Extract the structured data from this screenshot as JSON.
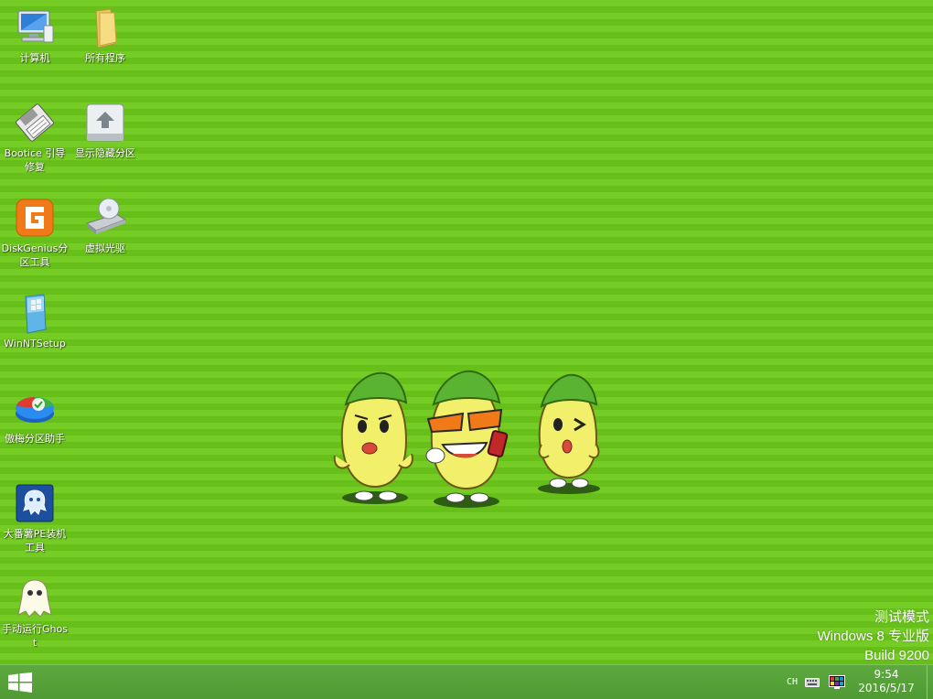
{
  "desktop": {
    "icons": [
      {
        "label": "计算机",
        "icon": "computer-icon"
      },
      {
        "label": "所有程序",
        "icon": "folder-icon"
      },
      {
        "label": "Bootice 引导修复",
        "icon": "bootice-icon"
      },
      {
        "label": "显示隐藏分区",
        "icon": "partition-icon"
      },
      {
        "label": "DiskGenius分区工具",
        "icon": "diskgenius-icon"
      },
      {
        "label": "虚拟光驱",
        "icon": "virtual-drive-icon"
      },
      {
        "label": "WinNTSetup",
        "icon": "winntsetup-icon"
      },
      {
        "label": "傲梅分区助手",
        "icon": "aomei-icon"
      },
      {
        "label": "大番薯PE装机工具",
        "icon": "dafanshu-icon"
      },
      {
        "label": "手动运行Ghost",
        "icon": "ghost-icon"
      }
    ],
    "watermark": {
      "line1": "测试模式",
      "line2": "Windows 8 专业版",
      "line3": "Build 9200"
    },
    "wallpaper_colors": {
      "stripe_light": "#74cc25",
      "stripe_dark": "#67c01a"
    }
  },
  "taskbar": {
    "start_icon": "windows-logo-icon",
    "tray": {
      "ime": "CH",
      "keyboard_icon": "keyboard-icon",
      "display_icon": "display-icon"
    },
    "clock": {
      "time": "9:54",
      "date": "2016/5/17"
    }
  }
}
